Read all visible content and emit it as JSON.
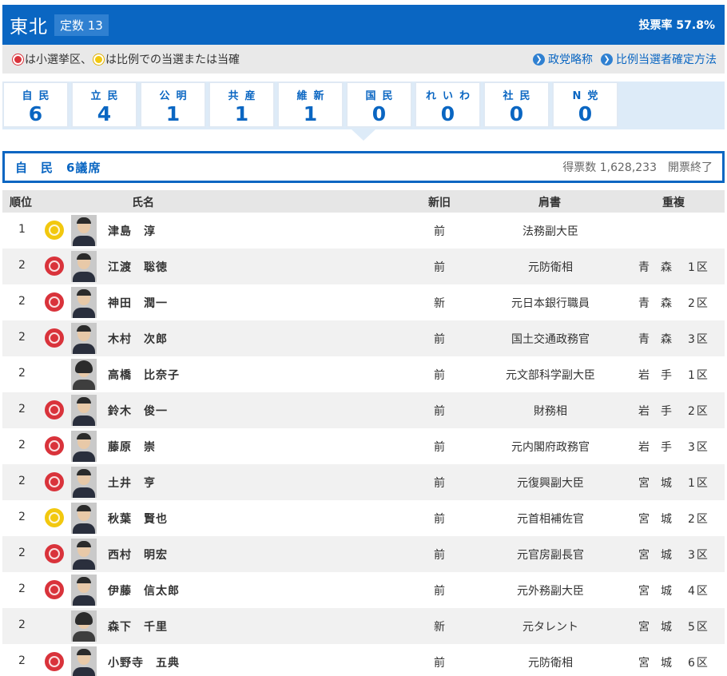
{
  "header": {
    "region": "東北",
    "seats": "定数 13",
    "turnout": "投票率 57.8%"
  },
  "legend": {
    "text": "は小選挙区、",
    "text2": "は比例での当選または当確",
    "link1": "政党略称",
    "link2": "比例当選者確定方法"
  },
  "parties": [
    {
      "name": "自民",
      "value": "6"
    },
    {
      "name": "立民",
      "value": "4"
    },
    {
      "name": "公明",
      "value": "1"
    },
    {
      "name": "共産",
      "value": "1"
    },
    {
      "name": "維新",
      "value": "1"
    },
    {
      "name": "国民",
      "value": "0"
    },
    {
      "name": "れいわ",
      "value": "0"
    },
    {
      "name": "社民",
      "value": "0"
    },
    {
      "name": "N党",
      "value": "0"
    }
  ],
  "panel": {
    "title": "自　民　6議席",
    "votes": "得票数 1,628,233　開票終了"
  },
  "table": {
    "headers": {
      "rank": "順位",
      "name": "氏名",
      "status": "新旧",
      "title": "肩書",
      "dup": "重複"
    },
    "rows": [
      {
        "rank": "1",
        "badge": "yellow",
        "name": "津島　淳",
        "status": "前",
        "title": "法務副大臣",
        "pref": "",
        "dist": ""
      },
      {
        "rank": "2",
        "badge": "red",
        "name": "江渡　聡徳",
        "status": "前",
        "title": "元防衛相",
        "pref": "青森",
        "dist": "1区"
      },
      {
        "rank": "2",
        "badge": "red",
        "name": "神田　潤一",
        "status": "新",
        "title": "元日本銀行職員",
        "pref": "青森",
        "dist": "2区"
      },
      {
        "rank": "2",
        "badge": "red",
        "name": "木村　次郎",
        "status": "前",
        "title": "国土交通政務官",
        "pref": "青森",
        "dist": "3区"
      },
      {
        "rank": "2",
        "badge": "",
        "name": "高橋　比奈子",
        "status": "前",
        "title": "元文部科学副大臣",
        "pref": "岩手",
        "dist": "1区"
      },
      {
        "rank": "2",
        "badge": "red",
        "name": "鈴木　俊一",
        "status": "前",
        "title": "財務相",
        "pref": "岩手",
        "dist": "2区"
      },
      {
        "rank": "2",
        "badge": "red",
        "name": "藤原　崇",
        "status": "前",
        "title": "元内閣府政務官",
        "pref": "岩手",
        "dist": "3区"
      },
      {
        "rank": "2",
        "badge": "red",
        "name": "土井　亨",
        "status": "前",
        "title": "元復興副大臣",
        "pref": "宮城",
        "dist": "1区"
      },
      {
        "rank": "2",
        "badge": "yellow",
        "name": "秋葉　賢也",
        "status": "前",
        "title": "元首相補佐官",
        "pref": "宮城",
        "dist": "2区"
      },
      {
        "rank": "2",
        "badge": "red",
        "name": "西村　明宏",
        "status": "前",
        "title": "元官房副長官",
        "pref": "宮城",
        "dist": "3区"
      },
      {
        "rank": "2",
        "badge": "red",
        "name": "伊藤　信太郎",
        "status": "前",
        "title": "元外務副大臣",
        "pref": "宮城",
        "dist": "4区"
      },
      {
        "rank": "2",
        "badge": "",
        "name": "森下　千里",
        "status": "新",
        "title": "元タレント",
        "pref": "宮城",
        "dist": "5区"
      },
      {
        "rank": "2",
        "badge": "red",
        "name": "小野寺　五典",
        "status": "前",
        "title": "元防衛相",
        "pref": "宮城",
        "dist": "6区"
      }
    ]
  },
  "colors": {
    "brand": "#0a66c2",
    "red_badge": "#d9333b",
    "yellow_badge": "#f2c80f"
  }
}
